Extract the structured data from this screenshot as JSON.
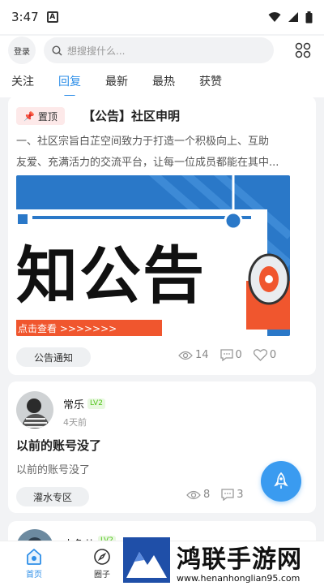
{
  "status": {
    "time": "3:47",
    "a_icon": "A"
  },
  "header": {
    "login": "登录",
    "search_placeholder": "想搜搜什么..."
  },
  "tabs": [
    {
      "label": "关注"
    },
    {
      "label": "回复"
    },
    {
      "label": "最新"
    },
    {
      "label": "最热"
    },
    {
      "label": "获赞"
    }
  ],
  "pinned_post": {
    "pin_label": "置顶",
    "title": "【公告】社区申明",
    "body_line1": "一、社区宗旨白芷空间致力于打造一个积极向上、互助",
    "body_line2": "友爱、充满活力的交流平台，让每一位成员都能在其中...",
    "banner_text": "知公告",
    "banner_sub": "点击查看 >>>>>>>",
    "tag": "公告通知",
    "views": "14",
    "comments": "0",
    "likes": "0"
  },
  "post2": {
    "user": "常乐",
    "level": "LV2",
    "time": "4天前",
    "title": "以前的账号没了",
    "body": "以前的账号没了",
    "tag": "灌水专区",
    "views": "8",
    "comments": "3"
  },
  "post3": {
    "user": "小鱼儿",
    "level": "LV2"
  },
  "bottom_nav": [
    {
      "label": "首页"
    },
    {
      "label": "圈子"
    }
  ],
  "watermark": {
    "title": "鸿联手游网",
    "url": "www.henanhonglian95.com"
  },
  "colors": {
    "accent": "#2f8fe8",
    "fab": "#3a9bf0",
    "banner_blue": "#2a78c8",
    "banner_orange": "#f0562e"
  }
}
